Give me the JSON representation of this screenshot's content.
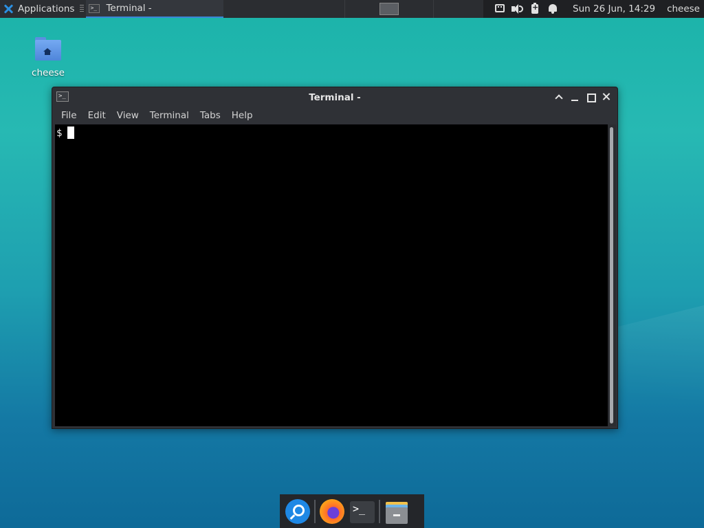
{
  "top_panel": {
    "applications_label": "Applications",
    "task_title": "Terminal -",
    "clock": "Sun 26 Jun, 14:29",
    "user": "cheese",
    "tray_icons": [
      "network-icon",
      "volume-icon",
      "battery-icon",
      "notification-bell-icon"
    ]
  },
  "desktop": {
    "home_icon_label": "cheese"
  },
  "terminal": {
    "title": "Terminal -",
    "menu": [
      "File",
      "Edit",
      "View",
      "Terminal",
      "Tabs",
      "Help"
    ],
    "prompt": "$",
    "icon_glyph": ">_"
  },
  "dock": {
    "items": [
      "app-finder",
      "firefox",
      "terminal",
      "file-manager"
    ]
  },
  "colors": {
    "panel_bg": "#2b2d31",
    "accent": "#3b86d8",
    "terminal_bg": "#000000",
    "desktop_teal": "#27b9b3"
  }
}
